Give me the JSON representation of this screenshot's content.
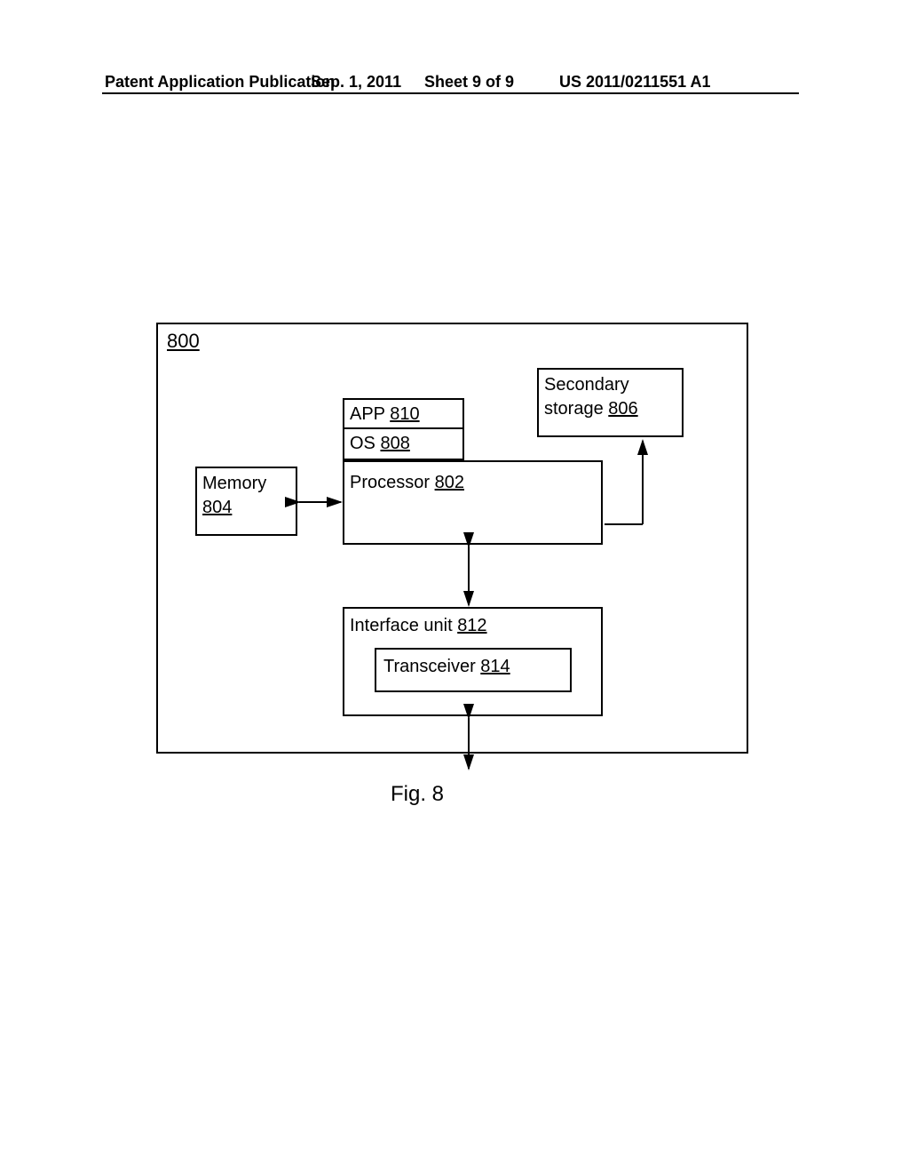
{
  "header": {
    "left": "Patent Application Publication",
    "date": "Sep. 1, 2011",
    "sheet": "Sheet 9 of 9",
    "pubno": "US 2011/0211551 A1"
  },
  "diagram": {
    "ref": "800",
    "secondary_storage": {
      "label": "Secondary storage",
      "num": "806"
    },
    "app": {
      "label": "APP",
      "num": "810"
    },
    "os": {
      "label": "OS",
      "num": "808"
    },
    "processor": {
      "label": "Processor",
      "num": "802"
    },
    "memory": {
      "label": "Memory",
      "num": "804"
    },
    "interface": {
      "label": "Interface unit",
      "num": "812"
    },
    "transceiver": {
      "label": "Transceiver",
      "num": "814"
    }
  },
  "figure_caption": "Fig. 8"
}
